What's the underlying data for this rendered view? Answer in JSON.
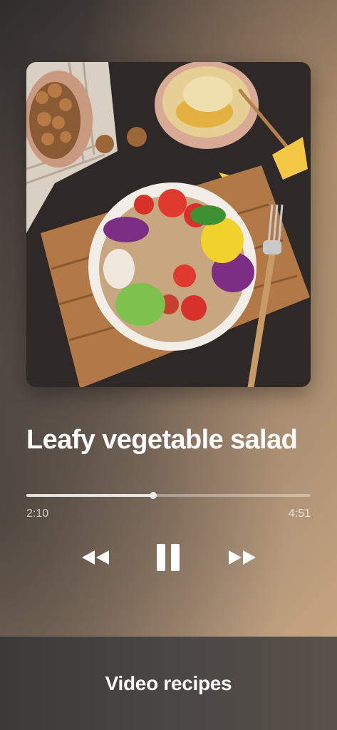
{
  "player": {
    "track_title": "Leafy vegetable salad",
    "elapsed": "2:10",
    "duration": "4:51",
    "progress_fraction": 0.4467,
    "controls": {
      "rewind_icon": "rewind-icon",
      "pause_icon": "pause-icon",
      "forward_icon": "fast-forward-icon"
    }
  },
  "bottom_bar": {
    "label": "Video recipes"
  }
}
